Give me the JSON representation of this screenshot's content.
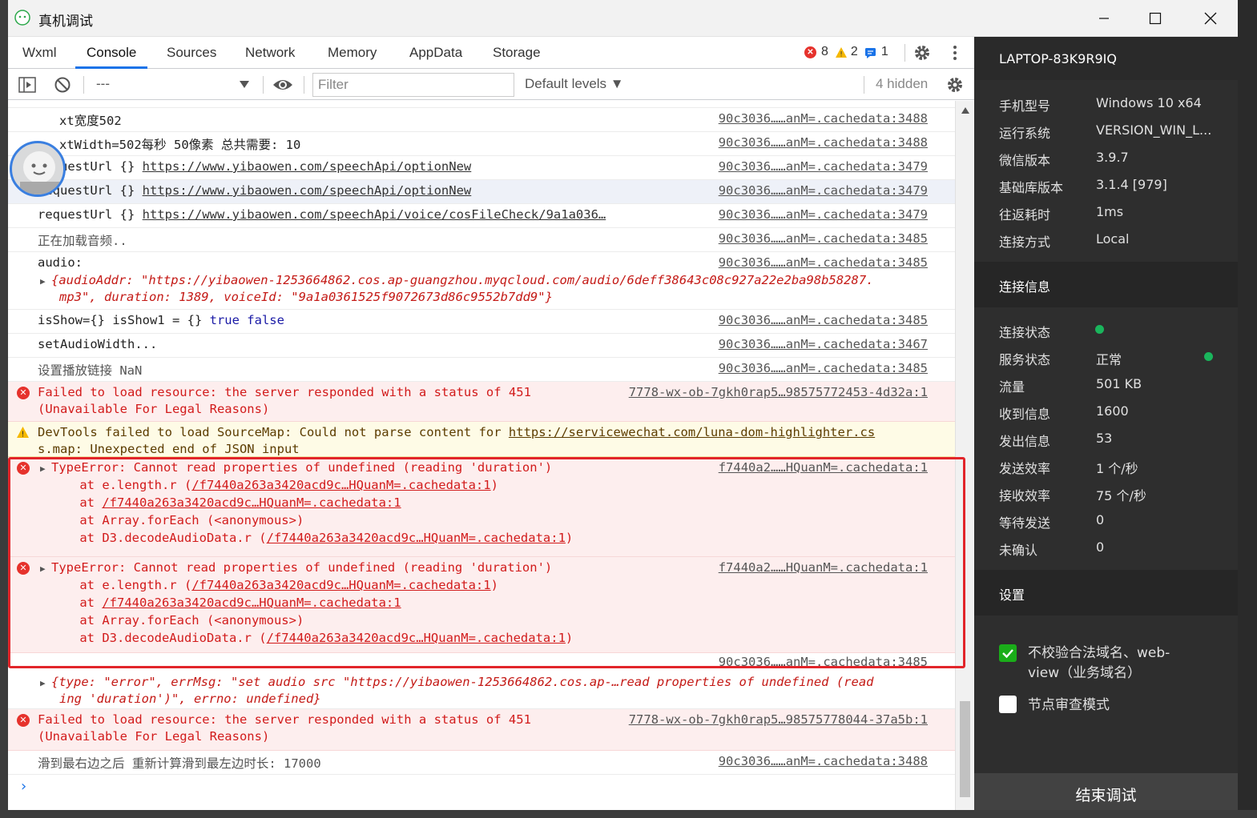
{
  "window": {
    "title": "真机调试"
  },
  "tabs": [
    "Wxml",
    "Console",
    "Sources",
    "Network",
    "Memory",
    "AppData",
    "Storage"
  ],
  "counts": {
    "errors": "8",
    "warnings": "2",
    "info": "1"
  },
  "toolbar": {
    "context": "---",
    "filter_placeholder": "Filter",
    "levels": "Default levels ▼",
    "hidden": "4 hidden"
  },
  "console": [
    {
      "msg": "xt宽度502",
      "src": "90c3036……anM=.cachedata:3488"
    },
    {
      "msg": "xtWidth=502每秒 50像素 总共需要: 10",
      "src": "90c3036……anM=.cachedata:3488"
    },
    {
      "msg": "requestUrl {} ",
      "link": "https://www.yibaowen.com/speechApi/optionNew",
      "src": "90c3036……anM=.cachedata:3479"
    },
    {
      "msg": "requestUrl {} ",
      "link": "https://www.yibaowen.com/speechApi/optionNew",
      "src": "90c3036……anM=.cachedata:3479"
    },
    {
      "msg": "requestUrl {} ",
      "link": "https://www.yibaowen.com/speechApi/voice/cosFileCheck/9a1a036…",
      "src": "90c3036……anM=.cachedata:3479"
    },
    {
      "msg": "正在加载音频..",
      "src": "90c3036……anM=.cachedata:3485"
    },
    {
      "msg": "audio:",
      "src": "90c3036……anM=.cachedata:3485",
      "obj1": "{audioAddr: \"https://yibaowen-1253664862.cos.ap-guangzhou.myqcloud.com/audio/6deff38643c08c927a22e2ba98b58287.",
      "obj2": "mp3\", duration: 1389, voiceId: \"9a1a0361525f9072673d86c9552b7dd9\"}"
    },
    {
      "msg_a": "isShow={} isShow1 = {} ",
      "msg_b": "true false",
      "src": "90c3036……anM=.cachedata:3485"
    },
    {
      "msg": "setAudioWidth...",
      "src": "90c3036……anM=.cachedata:3467"
    },
    {
      "msg": "设置播放链接 NaN",
      "src": "90c3036……anM=.cachedata:3485"
    },
    {
      "msg": "Failed to load resource: the server responded with a status of 451",
      "msg2": "(Unavailable For Legal Reasons)",
      "src": "7778-wx-ob-7gkh0rap5…98575772453-4d32a:1"
    },
    {
      "msg": "DevTools failed to load SourceMap: Could not parse content for ",
      "link": "https://servicewechat.com/luna-dom-highlighter.cs",
      "msg2": "s.map: Unexpected end of JSON input"
    },
    {
      "msg": "TypeError: Cannot read properties of undefined (reading 'duration')",
      "src": "f7440a2……HQuanM=.cachedata:1",
      "stack": [
        {
          "pre": "    at e.length.r (",
          "link": "/f7440a263a3420acd9c…HQuanM=.cachedata:1",
          "post": ")"
        },
        {
          "pre": "    at ",
          "link": "/f7440a263a3420acd9c…HQuanM=.cachedata:1",
          "post": ""
        },
        {
          "pre": "    at Array.forEach (<anonymous>)",
          "link": "",
          "post": ""
        },
        {
          "pre": "    at D3.decodeAudioData.r (",
          "link": "/f7440a263a3420acd9c…HQuanM=.cachedata:1",
          "post": ")"
        }
      ]
    },
    {
      "msg": "TypeError: Cannot read properties of undefined (reading 'duration')",
      "src": "f7440a2……HQuanM=.cachedata:1",
      "stack": [
        {
          "pre": "    at e.length.r (",
          "link": "/f7440a263a3420acd9c…HQuanM=.cachedata:1",
          "post": ")"
        },
        {
          "pre": "    at ",
          "link": "/f7440a263a3420acd9c…HQuanM=.cachedata:1",
          "post": ""
        },
        {
          "pre": "    at Array.forEach (<anonymous>)",
          "link": "",
          "post": ""
        },
        {
          "pre": "    at D3.decodeAudioData.r (",
          "link": "/f7440a263a3420acd9c…HQuanM=.cachedata:1",
          "post": ")"
        }
      ]
    },
    {
      "src": "90c3036……anM=.cachedata:3485",
      "obj1": "{type: \"error\", errMsg: \"set audio src \"https://yibaowen-1253664862.cos.ap-…read properties of undefined (read",
      "obj2": "ing 'duration')\", errno: undefined}"
    },
    {
      "msg": "Failed to load resource: the server responded with a status of 451",
      "msg2": "(Unavailable For Legal Reasons)",
      "src": "7778-wx-ob-7gkh0rap5…98575778044-37a5b:1"
    },
    {
      "msg": "滑到最右边之后 重新计算滑到最左边时长: 17000",
      "src": "90c3036……anM=.cachedata:3488"
    }
  ],
  "panel": {
    "host": "LAPTOP-83K9R9IQ",
    "device": [
      {
        "label": "手机型号",
        "value": "Windows 10 x64"
      },
      {
        "label": "运行系统",
        "value": "VERSION_WIN_L..."
      },
      {
        "label": "微信版本",
        "value": "3.9.7"
      },
      {
        "label": "基础库版本",
        "value": "3.1.4 [979]"
      },
      {
        "label": "往返耗时",
        "value": "1ms"
      },
      {
        "label": "连接方式",
        "value": "Local"
      }
    ],
    "conn_title": "连接信息",
    "conn": [
      {
        "label": "连接状态",
        "value": ""
      },
      {
        "label": "服务状态",
        "value": "正常"
      },
      {
        "label": "流量",
        "value": "501 KB"
      },
      {
        "label": "收到信息",
        "value": "1600"
      },
      {
        "label": "发出信息",
        "value": "53"
      },
      {
        "label": "发送效率",
        "value": "1 个/秒"
      },
      {
        "label": "接收效率",
        "value": "75 个/秒"
      },
      {
        "label": "等待发送",
        "value": "0"
      },
      {
        "label": "未确认",
        "value": "0"
      }
    ],
    "settings_title": "设置",
    "opt1_line1": "不校验合法域名、web-",
    "opt1_line2": "view（业务域名）",
    "opt1_checked": true,
    "opt2": "节点审查模式",
    "opt2_checked": false,
    "end_button": "结束调试"
  },
  "colors": {
    "accent": "#1a73e8",
    "error": "#d21b1b",
    "ok": "#1ab55c",
    "highlight": "#e2252a"
  }
}
